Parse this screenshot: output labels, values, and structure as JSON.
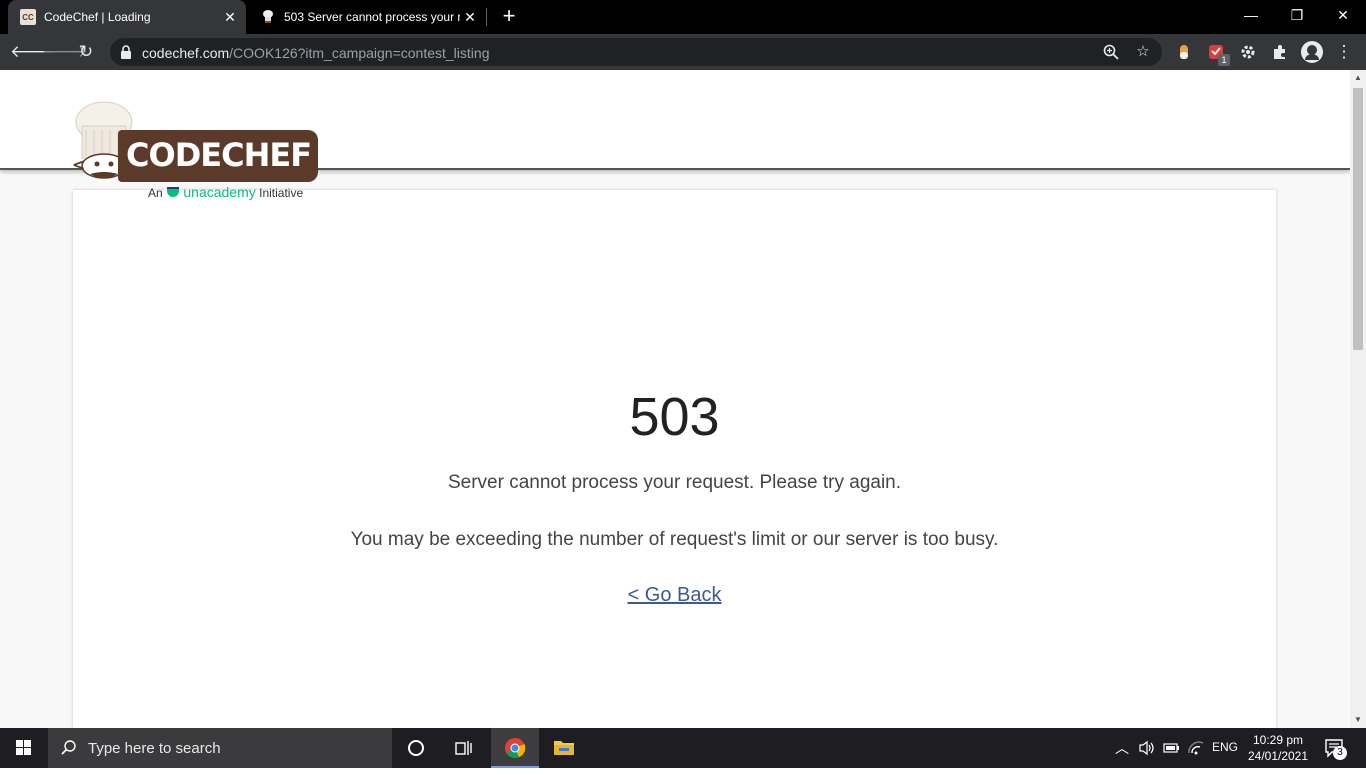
{
  "browser": {
    "tabs": [
      {
        "title": "CodeChef | Loading",
        "favicon": "CC",
        "close": "✕"
      },
      {
        "title": "503 Server cannot process your r",
        "close": "✕"
      }
    ],
    "new_tab": "+",
    "window_controls": {
      "minimize": "—",
      "restore": "❐",
      "close": "✕"
    },
    "url_domain": "codechef.com",
    "url_path": "/COOK126?itm_campaign=contest_listing"
  },
  "site": {
    "logo_text": "CODECHEF",
    "logo_prefix": "An",
    "logo_brand": "unacademy",
    "logo_suffix": "Initiative"
  },
  "error": {
    "code": "503",
    "message": "Server cannot process your request. Please try again.",
    "detail": "You may be exceeding the number of request's limit or our server is too busy.",
    "back_link": "< Go Back"
  },
  "taskbar": {
    "search_placeholder": "Type here to search",
    "language": "ENG",
    "time": "10:29 pm",
    "date": "24/01/2021",
    "notification_count": "3"
  },
  "extensions": {
    "badge_count": "1"
  }
}
